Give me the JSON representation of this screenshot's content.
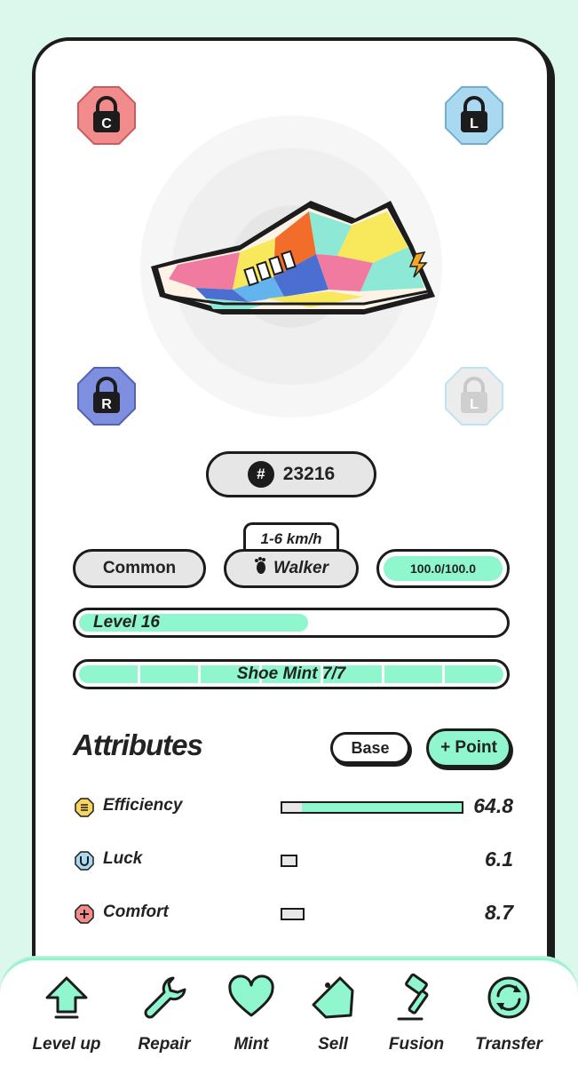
{
  "shoe": {
    "id": "23216",
    "id_prefix": "#",
    "rarity": "Common",
    "speed_range": "1-6 km/h",
    "type": "Walker",
    "durability": "100.0/100.0",
    "durability_fraction": 1.0,
    "level_label": "Level 16",
    "level_progress": 0.53,
    "mint_label": "Shoe Mint 7/7",
    "mint_segments": 7,
    "sockets": [
      {
        "letter": "C",
        "color": "#f28b8b"
      },
      {
        "letter": "L",
        "color": "#a9d8f0"
      },
      {
        "letter": "R",
        "color": "#7f8fe0"
      },
      {
        "letter": "L",
        "color": "#e4e4e4"
      }
    ]
  },
  "attributes": {
    "title": "Attributes",
    "base_button": "Base",
    "point_button": "+ Point",
    "items": [
      {
        "name": "Efficiency",
        "value": "64.8",
        "icon": "efficiency-icon",
        "base_fraction": 0.11,
        "fill_fraction": 0.89,
        "color": "#f7d560"
      },
      {
        "name": "Luck",
        "value": "6.1",
        "icon": "luck-icon",
        "base_fraction": 0.09,
        "fill_fraction": 0,
        "color": "#a9d8f0"
      },
      {
        "name": "Comfort",
        "value": "8.7",
        "icon": "comfort-icon",
        "base_fraction": 0.13,
        "fill_fraction": 0,
        "color": "#f28b8b"
      }
    ]
  },
  "nav": {
    "items": [
      {
        "label": "Level up",
        "icon": "level-up-icon"
      },
      {
        "label": "Repair",
        "icon": "wrench-icon"
      },
      {
        "label": "Mint",
        "icon": "heart-icon"
      },
      {
        "label": "Sell",
        "icon": "tag-icon"
      },
      {
        "label": "Fusion",
        "icon": "hammer-icon"
      },
      {
        "label": "Transfer",
        "icon": "transfer-icon"
      }
    ]
  },
  "colors": {
    "accent": "#8ff6cd",
    "background": "#dcf8ec",
    "outline": "#1c1c1c"
  }
}
